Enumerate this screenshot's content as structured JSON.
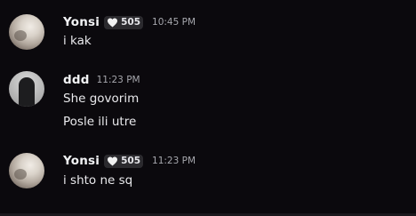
{
  "messages": [
    {
      "author": "Yonsi",
      "badge_count": "505",
      "timestamp": "10:45 PM",
      "lines": [
        "i kak"
      ]
    },
    {
      "author": "ddd",
      "timestamp": "11:23 PM",
      "lines": [
        "She govorim",
        "Posle ili utre"
      ]
    },
    {
      "author": "Yonsi",
      "badge_count": "505",
      "timestamp": "11:23 PM",
      "lines": [
        "i shto ne sq"
      ]
    }
  ],
  "colors": {
    "background": "#0b090d",
    "username": "#f2f3f5",
    "message_text": "#e9e9ec",
    "timestamp": "#a6a7ad",
    "badge_bg": "#2b2a2e"
  },
  "icons": {
    "badge_icon": "heart-icon"
  }
}
